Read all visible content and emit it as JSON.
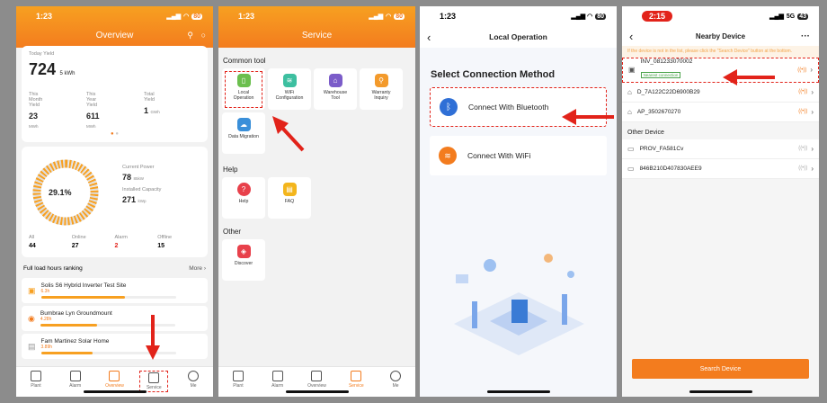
{
  "s1": {
    "time": "1:23",
    "battery": "80",
    "title": "Overview",
    "today_label": "Today Yield",
    "today_value": "724",
    "today_unit": "5 kWh",
    "yields": [
      {
        "label": "This Month\nYield",
        "value": "23",
        "unit": "MWh"
      },
      {
        "label": "This Year\nYield",
        "value": "611",
        "unit": "MWh"
      },
      {
        "label": "Total\nYield",
        "value": "1",
        "unit": "GWh"
      }
    ],
    "percent": "29.1%",
    "current_power_label": "Current Power",
    "current_power": "78",
    "current_power_unit": "85kW",
    "capacity_label": "Installed Capacity",
    "capacity": "271",
    "capacity_unit": "kWp",
    "stats": [
      {
        "label": "All",
        "value": "44"
      },
      {
        "label": "Online",
        "value": "27"
      },
      {
        "label": "Alarm",
        "value": "2"
      },
      {
        "label": "Offline",
        "value": "15"
      }
    ],
    "ranking_title": "Full load hours ranking",
    "more": "More",
    "rank": [
      {
        "name": "Solis S6 Hybrid Inverter Test Site",
        "val": "6.3h",
        "fill": 0.62
      },
      {
        "name": "Bumbrae Lyn Groundmount",
        "val": "4.28h",
        "fill": 0.42
      },
      {
        "name": "Fam Martinez Solar Home",
        "val": "3.89h",
        "fill": 0.38
      }
    ],
    "tabs": [
      "Plant",
      "Alarm",
      "Overview",
      "Service",
      "Me"
    ]
  },
  "s2": {
    "time": "1:23",
    "battery": "80",
    "title": "Service",
    "common": "Common tool",
    "tools": [
      "Local\nOperation",
      "WiFi\nConfiguration",
      "Warehouse\nTool",
      "Warranty\nInquiry",
      "Data Migration"
    ],
    "help": "Help",
    "help_tools": [
      "Help",
      "FAQ"
    ],
    "other": "Other",
    "other_tools": [
      "Discover"
    ],
    "tabs": [
      "Plant",
      "Alarm",
      "Overview",
      "Service",
      "Me"
    ]
  },
  "s3": {
    "time": "1:23",
    "battery": "80",
    "title": "Local Operation",
    "heading": "Select Connection Method",
    "bluetooth": "Connect With Bluetooth",
    "wifi": "Connect With WiFi"
  },
  "s4": {
    "time": "2:15",
    "network": "5G",
    "battery": "43",
    "title": "Nearby Device",
    "menu": "···",
    "notice": "If the device is not in the list, please click the \"Search Device\" button at the bottom.",
    "devices": [
      {
        "name": "INV_081233070002",
        "tag": "Nearest connection"
      },
      {
        "name": "D_7A122C22D6900B29"
      },
      {
        "name": "AP_3502670270"
      }
    ],
    "other_label": "Other Device",
    "other_devices": [
      "PROV_FA581Cv",
      "846B210D407830AEE9"
    ],
    "search": "Search Device"
  },
  "colors": {
    "orange": "#f37c1e",
    "red": "#e2231a",
    "blue": "#2f6fd6"
  }
}
